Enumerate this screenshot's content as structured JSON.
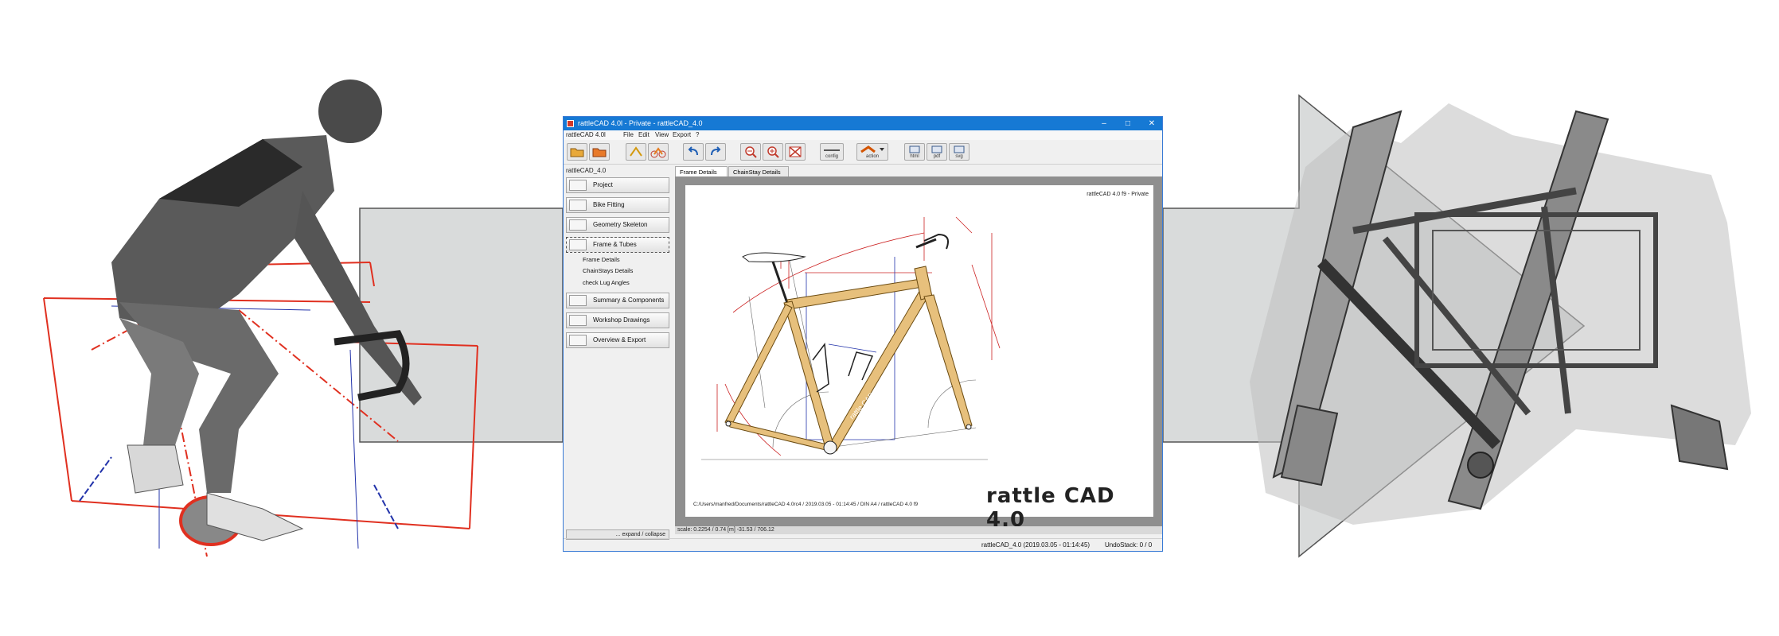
{
  "window": {
    "title": "rattleCAD 4.0l - Private - rattleCAD_4.0",
    "controls": [
      "–",
      "□",
      "✕"
    ]
  },
  "menu": {
    "items": [
      "rattleCAD 4.0l",
      "File",
      "Edit",
      "View",
      "Export",
      "?"
    ]
  },
  "toolbar": {
    "buttons": [
      {
        "name": "open",
        "label": ""
      },
      {
        "name": "save",
        "label": ""
      },
      {
        "name": "tool-a",
        "label": ""
      },
      {
        "name": "tool-b",
        "label": ""
      },
      {
        "name": "undo",
        "label": ""
      },
      {
        "name": "redo",
        "label": ""
      },
      {
        "name": "zoom-out",
        "label": ""
      },
      {
        "name": "zoom-in",
        "label": ""
      },
      {
        "name": "zoom-fit",
        "label": ""
      },
      {
        "name": "config",
        "label": "config"
      },
      {
        "name": "action",
        "label": "action"
      },
      {
        "name": "html",
        "label": "html"
      },
      {
        "name": "pdf",
        "label": "pdf"
      },
      {
        "name": "svg",
        "label": "svg"
      }
    ]
  },
  "sidebar": {
    "project_label": "rattleCAD_4.0",
    "items": [
      {
        "label": "Project"
      },
      {
        "label": "Bike Fitting"
      },
      {
        "label": "Geometry Skeleton"
      },
      {
        "label": "Frame & Tubes"
      },
      {
        "label": "Summary & Components"
      },
      {
        "label": "Workshop Drawings"
      },
      {
        "label": "Overview & Export"
      }
    ],
    "sub_items": [
      "Frame Details",
      "ChainStays Details",
      "check Lug Angles"
    ],
    "expand_label": "... expand / collapse"
  },
  "tabs": [
    "Frame Details",
    "ChainStay Details"
  ],
  "drawing": {
    "header": "rattleCAD 4.0 f9 - Private",
    "path_line": "C:/Users/manfred/Documents/rattleCAD 4.0rc4   /   2019.03.05 - 01:14:45   /   DIN A4   /   rattleCAD   4.0 f9",
    "logo": "rattle CAD 4.0",
    "downtube_text": "rattle CAD"
  },
  "scale_line": "scale: 0.2254 / 0.74  [m]   -31.53 / 706.12",
  "status": {
    "left": "rattleCAD_4.0 (2019.03.05 - 01:14:45)",
    "right": "UndoStack:  0 /  0"
  },
  "colors": {
    "titlebar": "#1679d4",
    "tube": "#e7c07c",
    "dimension": "#cc2222",
    "arrow_fill": "#d9dbdb"
  }
}
